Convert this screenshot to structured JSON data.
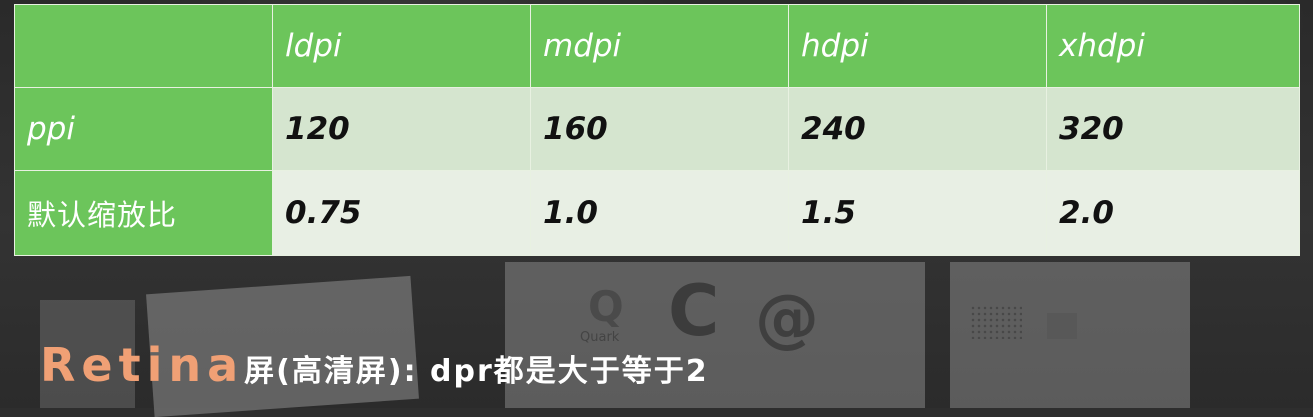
{
  "table": {
    "corner": "",
    "columns": [
      "ldpi",
      "mdpi",
      "hdpi",
      "xhdpi"
    ],
    "rows": [
      {
        "label": "ppi",
        "values": [
          "120",
          "160",
          "240",
          "320"
        ]
      },
      {
        "label": "默认缩放比",
        "values": [
          "0.75",
          "1.0",
          "1.5",
          "2.0"
        ]
      }
    ]
  },
  "caption": {
    "brand": "Retina",
    "rest": "屏(高清屏): dpr都是大于等于2"
  },
  "background": {
    "logo_text": "Quark"
  },
  "colors": {
    "header_green": "#6cc55b",
    "row1_bg": "#d5e5cf",
    "row2_bg": "#e8efe4",
    "brand_orange": "#f0a075"
  }
}
